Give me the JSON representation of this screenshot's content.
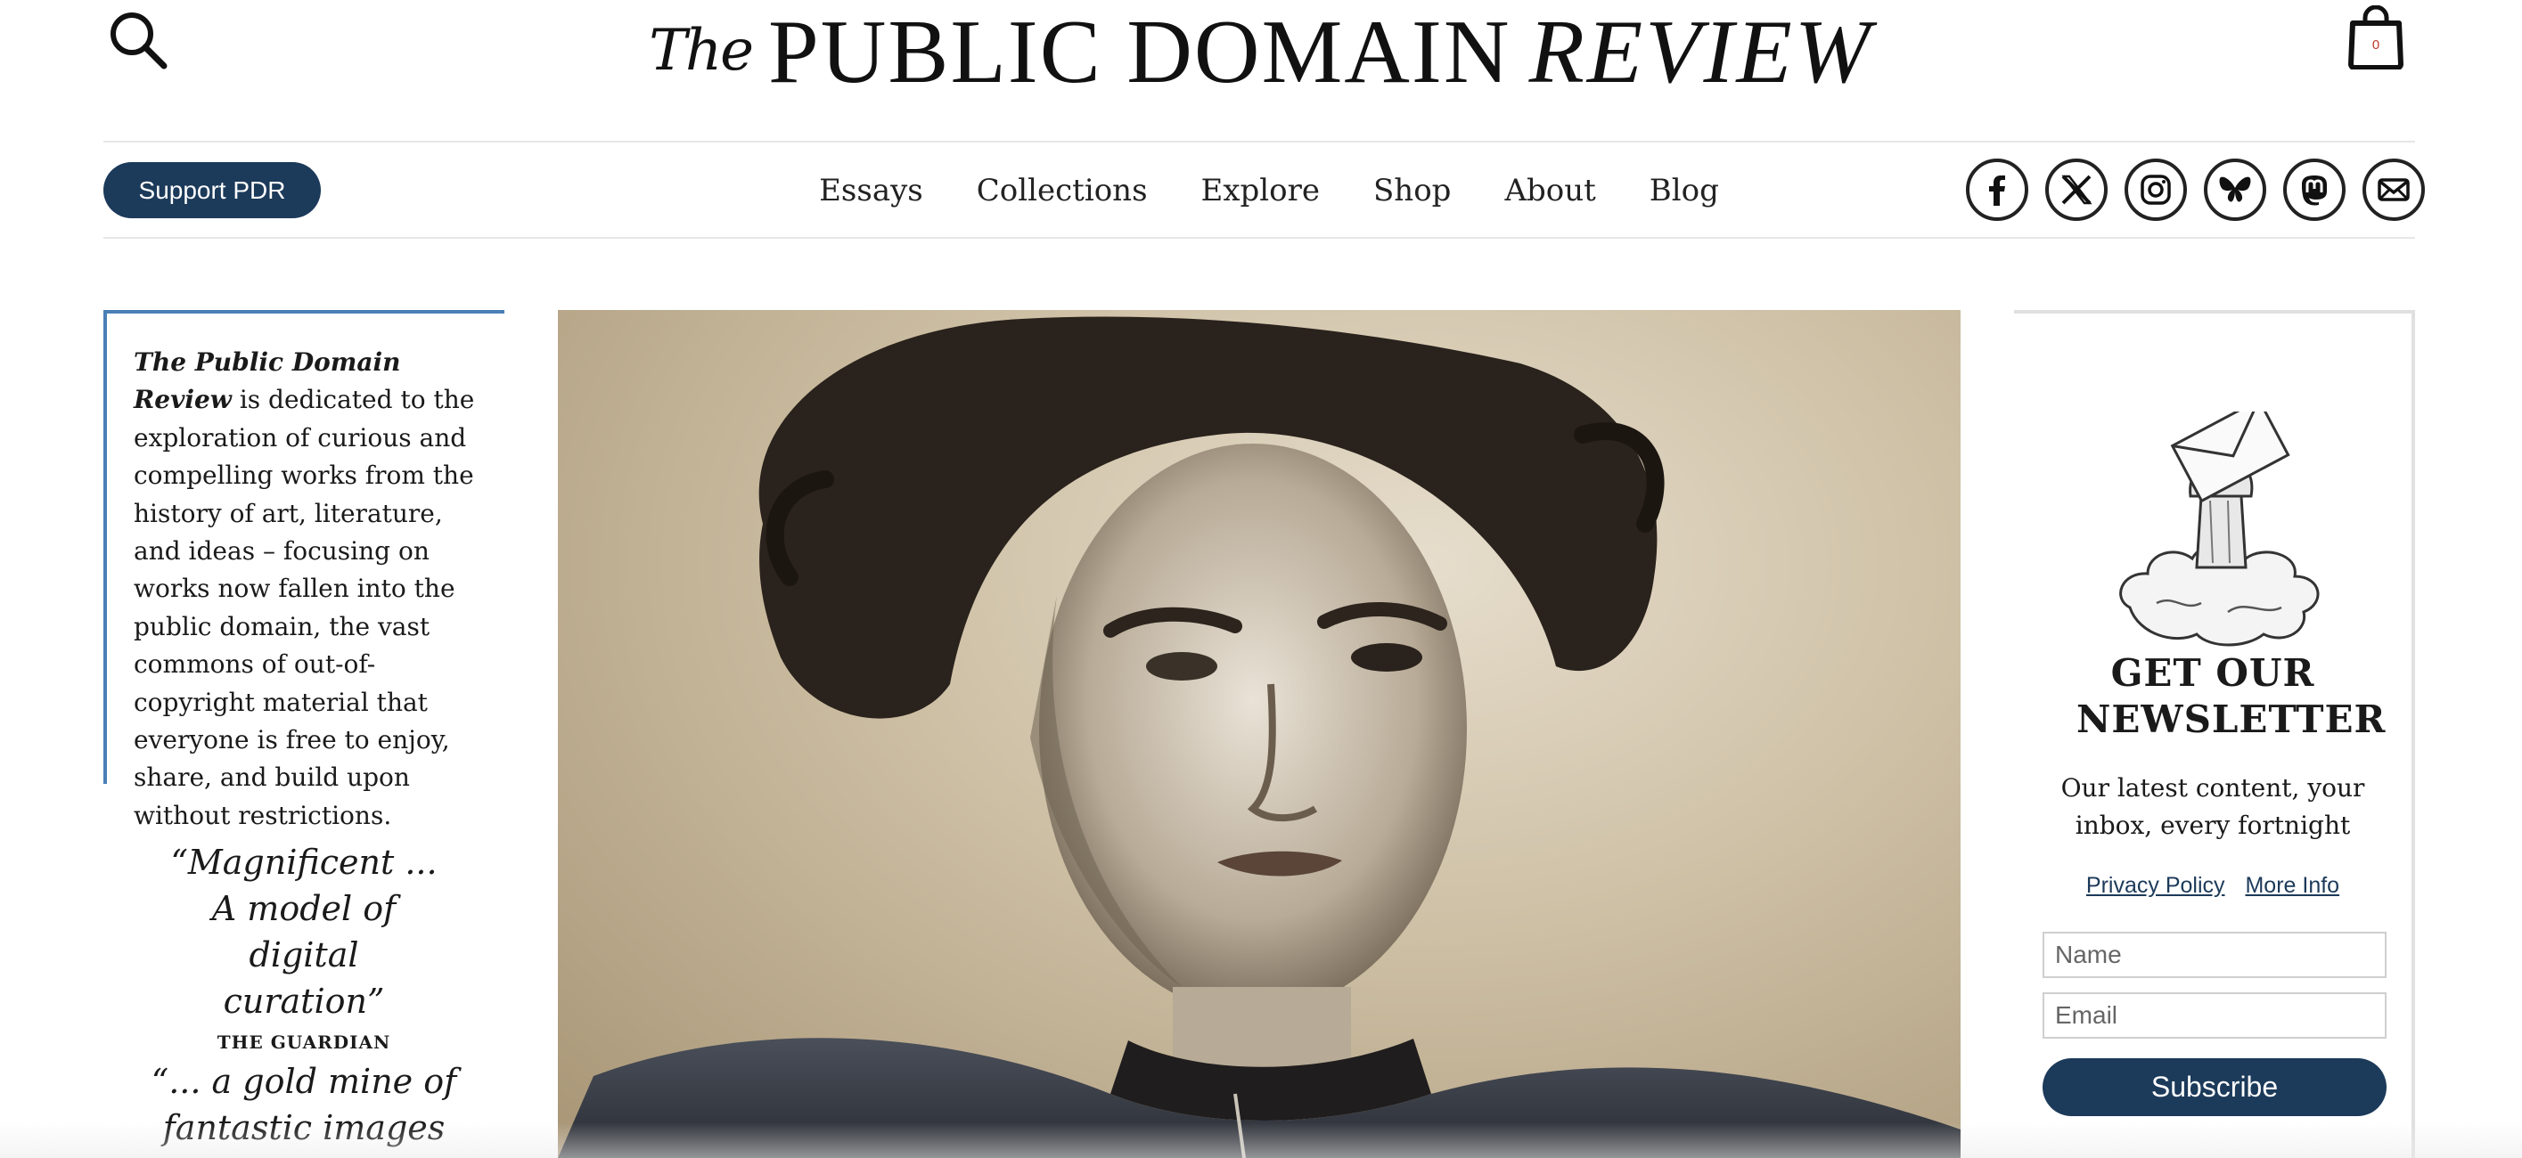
{
  "header": {
    "logo_the": "The",
    "logo_main": "PUBLIC DOMAIN",
    "logo_review": "REVIEW",
    "search_icon": "search-icon",
    "cart_icon": "shopping-bag-icon",
    "cart_count": "0"
  },
  "nav": {
    "support_label": "Support PDR",
    "items": [
      "Essays",
      "Collections",
      "Explore",
      "Shop",
      "About",
      "Blog"
    ],
    "socials": [
      "facebook-icon",
      "x-icon",
      "instagram-icon",
      "bluesky-icon",
      "mastodon-icon",
      "mail-icon"
    ]
  },
  "about": {
    "title": "The Public Domain Review",
    "text": " is dedicated to the exploration of curious and compelling works from the history of art, literature, and ideas – focusing on works now fallen into the public domain, the vast commons of out-of-copyright material that everyone is free to enjoy, share, and build upon without restrictions."
  },
  "quotes": [
    {
      "text": "“Magnificent ... A model of digital curation”",
      "source": "THE GUARDIAN"
    },
    {
      "text": "“... a gold mine of fantastic images and",
      "source": ""
    }
  ],
  "newsletter": {
    "title": "GET OUR NEWSLETTER",
    "description": "Our latest content, your inbox, every fortnight",
    "privacy_label": "Privacy Policy",
    "more_info_label": "More Info",
    "name_placeholder": "Name",
    "email_placeholder": "Email",
    "subscribe_label": "Subscribe"
  },
  "colors": {
    "primary": "#1c3a5a",
    "accent_border": "#4a7fb6",
    "text": "#1a1a1a"
  }
}
